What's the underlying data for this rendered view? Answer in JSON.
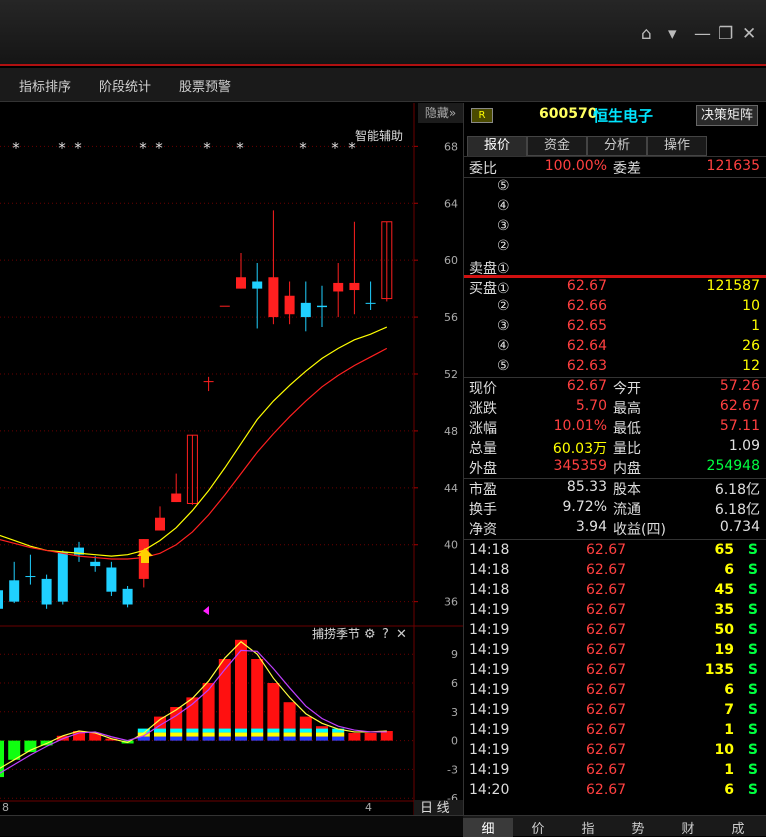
{
  "window": {
    "home_icon": "home-icon",
    "dropdown_icon": "dropdown-icon",
    "min_icon": "minimize-icon",
    "restore_icon": "restore-icon",
    "close_icon": "close-icon"
  },
  "menu": [
    "指标排序",
    "阶段统计",
    "股票预警"
  ],
  "chart": {
    "hide_label": "隐藏",
    "assist_label": "智能辅助",
    "indicator_name": "捕捞季节",
    "period_label": "日 线",
    "bottom_left_tick": "8",
    "bottom_right_tick": "4"
  },
  "quote": {
    "badge": "R",
    "code": "600570",
    "name": "恒生电子",
    "matrix_button": "决策矩阵",
    "tabs": [
      "报价",
      "资金",
      "分析",
      "操作"
    ],
    "weibi_label": "委比",
    "weibi_value": "100.00%",
    "weicha_label": "委差",
    "weicha_value": "121635",
    "sell": [
      {
        "label": "⑤",
        "price": "",
        "vol": ""
      },
      {
        "label": "④",
        "price": "",
        "vol": ""
      },
      {
        "label": "③",
        "price": "",
        "vol": ""
      },
      {
        "label": "②",
        "price": "",
        "vol": ""
      },
      {
        "label": "卖盘①",
        "price": "",
        "vol": ""
      }
    ],
    "buy": [
      {
        "label": "买盘①",
        "price": "62.67",
        "vol": "121587"
      },
      {
        "label": "②",
        "price": "62.66",
        "vol": "10"
      },
      {
        "label": "③",
        "price": "62.65",
        "vol": "1"
      },
      {
        "label": "④",
        "price": "62.64",
        "vol": "26"
      },
      {
        "label": "⑤",
        "price": "62.63",
        "vol": "12"
      }
    ],
    "stats": [
      {
        "l1": "现价",
        "v1": "62.67",
        "c1": "red",
        "l2": "今开",
        "v2": "57.26",
        "c2": "red"
      },
      {
        "l1": "涨跌",
        "v1": "5.70",
        "c1": "red",
        "l2": "最高",
        "v2": "62.67",
        "c2": "red"
      },
      {
        "l1": "涨幅",
        "v1": "10.01%",
        "c1": "red",
        "l2": "最低",
        "v2": "57.11",
        "c2": "red"
      },
      {
        "l1": "总量",
        "v1": "60.03万",
        "c1": "yel",
        "l2": "量比",
        "v2": "1.09",
        "c2": "wht"
      },
      {
        "l1": "外盘",
        "v1": "345359",
        "c1": "red",
        "l2": "内盘",
        "v2": "254948",
        "c2": "grn"
      }
    ],
    "fund": [
      {
        "l1": "市盈",
        "v1": "85.33",
        "l2": "股本",
        "v2": "6.18亿"
      },
      {
        "l1": "换手",
        "v1": "9.72%",
        "l2": "流通",
        "v2": "6.18亿"
      },
      {
        "l1": "净资",
        "v1": "3.94",
        "l2": "收益(四)",
        "v2": "0.734"
      }
    ],
    "ticks": [
      {
        "t": "14:18",
        "p": "62.67",
        "v": "65",
        "s": "S"
      },
      {
        "t": "14:18",
        "p": "62.67",
        "v": "6",
        "s": "S"
      },
      {
        "t": "14:18",
        "p": "62.67",
        "v": "45",
        "s": "S"
      },
      {
        "t": "14:19",
        "p": "62.67",
        "v": "35",
        "s": "S"
      },
      {
        "t": "14:19",
        "p": "62.67",
        "v": "50",
        "s": "S"
      },
      {
        "t": "14:19",
        "p": "62.67",
        "v": "19",
        "s": "S"
      },
      {
        "t": "14:19",
        "p": "62.67",
        "v": "135",
        "s": "S"
      },
      {
        "t": "14:19",
        "p": "62.67",
        "v": "6",
        "s": "S"
      },
      {
        "t": "14:19",
        "p": "62.67",
        "v": "7",
        "s": "S"
      },
      {
        "t": "14:19",
        "p": "62.67",
        "v": "1",
        "s": "S"
      },
      {
        "t": "14:19",
        "p": "62.67",
        "v": "10",
        "s": "S"
      },
      {
        "t": "14:19",
        "p": "62.67",
        "v": "1",
        "s": "S"
      },
      {
        "t": "14:20",
        "p": "62.67",
        "v": "6",
        "s": "S"
      }
    ],
    "bottom_tabs": [
      "细",
      "价",
      "指",
      "势",
      "财",
      "成"
    ]
  },
  "chart_data": [
    {
      "type": "candlestick",
      "title": "",
      "y_ticks": [
        68,
        64,
        60,
        56,
        52,
        48,
        44,
        40,
        36
      ],
      "ylim": [
        34.5,
        69.5
      ],
      "candles": [
        {
          "o": 35.5,
          "c": 36.8,
          "h": 37.0,
          "l": 34.8,
          "up": false
        },
        {
          "o": 36.0,
          "c": 37.5,
          "h": 38.8,
          "l": 35.9,
          "up": false
        },
        {
          "o": 37.8,
          "c": 37.8,
          "h": 39.3,
          "l": 37.2,
          "up": false
        },
        {
          "o": 37.6,
          "c": 35.8,
          "h": 37.9,
          "l": 35.5,
          "up": false
        },
        {
          "o": 36.0,
          "c": 39.5,
          "h": 39.6,
          "l": 35.8,
          "up": false
        },
        {
          "o": 39.3,
          "c": 39.8,
          "h": 40.2,
          "l": 38.8,
          "up": false
        },
        {
          "o": 38.8,
          "c": 38.5,
          "h": 39.2,
          "l": 38.1,
          "up": false
        },
        {
          "o": 38.4,
          "c": 36.7,
          "h": 38.8,
          "l": 36.4,
          "up": false
        },
        {
          "o": 36.9,
          "c": 35.8,
          "h": 37.1,
          "l": 35.6,
          "up": false
        },
        {
          "o": 37.6,
          "c": 40.4,
          "h": 40.4,
          "l": 37.0,
          "up": true
        },
        {
          "o": 41.0,
          "c": 41.9,
          "h": 42.7,
          "l": 41.0,
          "up": true
        },
        {
          "o": 43.0,
          "c": 43.6,
          "h": 45.0,
          "l": 43.0,
          "up": true
        },
        {
          "o": 42.9,
          "c": 47.7,
          "h": 47.7,
          "l": 42.8,
          "up": true
        },
        {
          "o": 51.5,
          "c": 51.5,
          "h": 51.8,
          "l": 50.8,
          "up": true
        },
        {
          "o": 56.8,
          "c": 56.8,
          "h": 56.8,
          "l": 56.8,
          "up": true
        },
        {
          "o": 58.0,
          "c": 58.8,
          "h": 60.5,
          "l": 58.0,
          "up": true
        },
        {
          "o": 58.5,
          "c": 58.0,
          "h": 59.8,
          "l": 55.2,
          "up": false
        },
        {
          "o": 56.0,
          "c": 58.8,
          "h": 63.5,
          "l": 55.5,
          "up": true
        },
        {
          "o": 57.5,
          "c": 56.2,
          "h": 58.5,
          "l": 55.5,
          "up": true
        },
        {
          "o": 57.0,
          "c": 56.0,
          "h": 58.5,
          "l": 55.0,
          "up": false
        },
        {
          "o": 56.8,
          "c": 56.7,
          "h": 58.2,
          "l": 55.3,
          "up": false
        },
        {
          "o": 57.8,
          "c": 58.4,
          "h": 59.8,
          "l": 56.0,
          "up": true
        },
        {
          "o": 58.4,
          "c": 57.9,
          "h": 62.7,
          "l": 56.2,
          "up": true
        },
        {
          "o": 57.0,
          "c": 57.0,
          "h": 58.5,
          "l": 56.5,
          "up": false
        },
        {
          "o": 57.3,
          "c": 62.7,
          "h": 62.7,
          "l": 57.1,
          "up": true
        }
      ],
      "ma_fast": [
        40.7,
        40.3,
        39.9,
        39.6,
        39.5,
        39.4,
        39.3,
        39.2,
        39.3,
        39.6,
        40.3,
        41.2,
        42.4,
        43.8,
        45.4,
        47.1,
        48.8,
        50.1,
        51.2,
        52.2,
        53.1,
        53.8,
        54.4,
        54.8,
        55.3
      ],
      "ma_slow": [
        40.4,
        40.1,
        39.8,
        39.6,
        39.4,
        39.2,
        39.1,
        39.0,
        39.0,
        39.1,
        39.4,
        40.0,
        40.9,
        42.1,
        43.5,
        45.0,
        46.5,
        47.8,
        49.0,
        50.1,
        51.1,
        51.9,
        52.6,
        53.2,
        53.8
      ]
    },
    {
      "type": "bar",
      "title": "捕捞季节",
      "y_ticks": [
        9,
        6,
        3,
        0,
        -3,
        -6
      ],
      "ylim": [
        -6.5,
        11
      ],
      "values": [
        -3.8,
        -2.0,
        -1.2,
        -0.5,
        0.5,
        1.0,
        0.8,
        0.2,
        -0.3,
        1.0,
        2.5,
        3.5,
        4.5,
        6.0,
        8.5,
        10.5,
        8.5,
        6.0,
        4.0,
        2.5,
        1.5,
        1.0,
        0.8,
        0.8,
        1.0
      ],
      "line_a": [
        -3.0,
        -2.0,
        -1.0,
        -0.3,
        0.5,
        1.0,
        0.8,
        0.2,
        -0.2,
        0.8,
        2.2,
        3.2,
        4.4,
        6.2,
        8.6,
        10.3,
        9.0,
        6.5,
        4.5,
        2.8,
        1.8,
        1.2,
        0.9,
        0.9,
        1.0
      ],
      "line_b": [
        -3.5,
        -2.5,
        -1.5,
        -0.6,
        0.2,
        0.8,
        0.9,
        0.4,
        0.0,
        0.5,
        1.6,
        2.6,
        3.8,
        5.3,
        7.4,
        9.4,
        9.3,
        7.5,
        5.5,
        3.6,
        2.3,
        1.5,
        1.1,
        0.9,
        0.9
      ]
    }
  ]
}
